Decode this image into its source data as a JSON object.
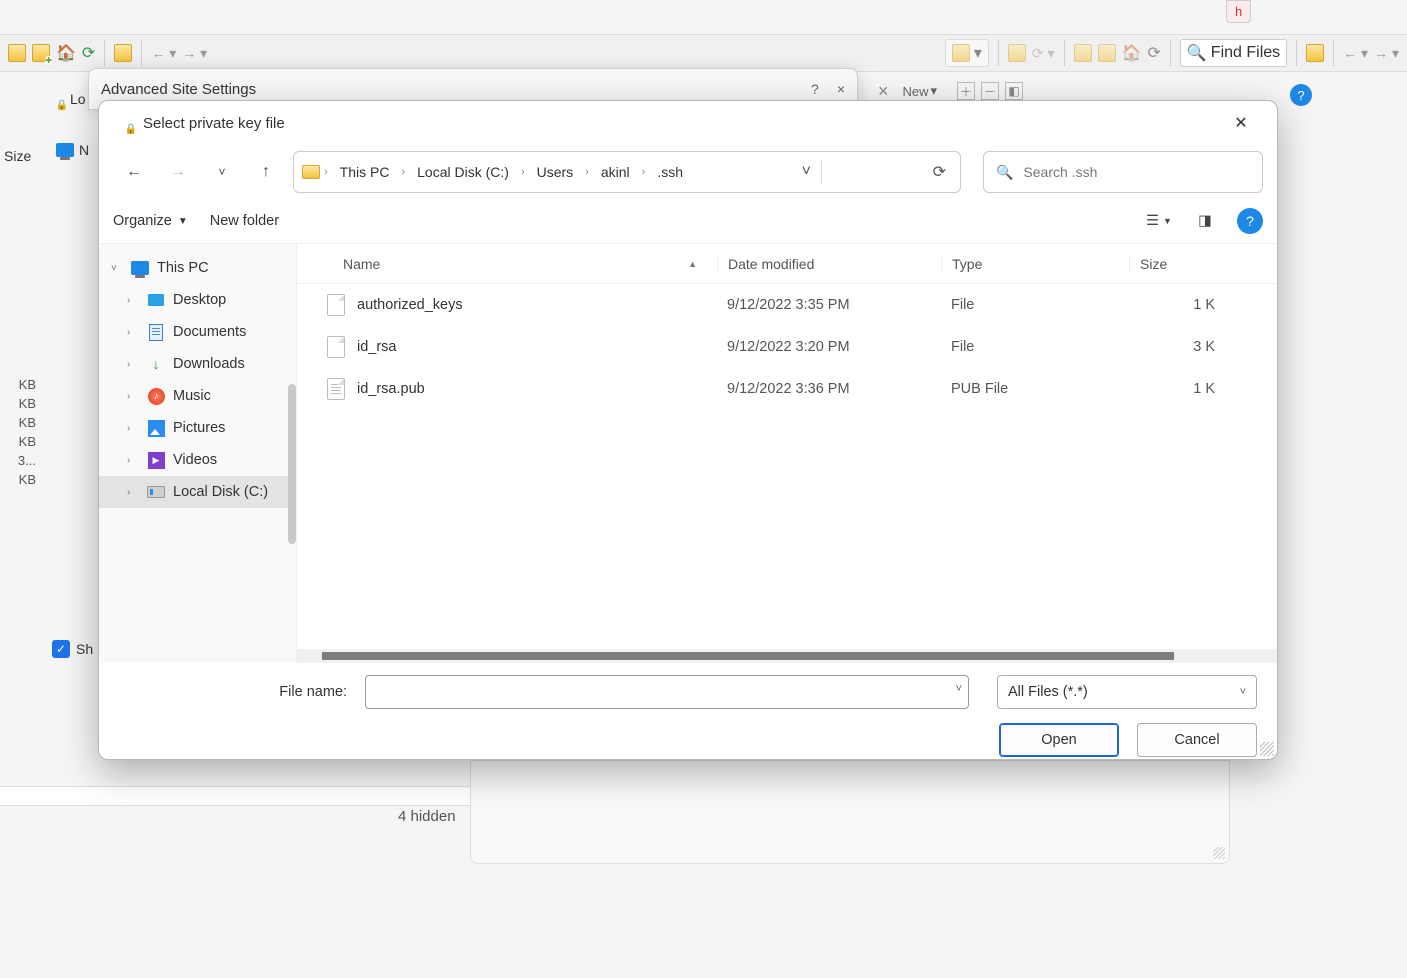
{
  "bg": {
    "h_tab": "h",
    "find_files": "Find Files",
    "new_label": "New",
    "size_hdr": "Size",
    "lo_label": "Lo",
    "n_label": "N",
    "sh_label": "Sh",
    "hidden_status": "4 hidden",
    "kb_rows": [
      "KB",
      "KB",
      "KB",
      "KB",
      "3...",
      "KB"
    ]
  },
  "adv_window": {
    "title": "Advanced Site Settings",
    "help": "?",
    "close": "×"
  },
  "dialog": {
    "title": "Select private key file",
    "nav": {
      "back": "←",
      "fwd": "→",
      "recent": "˅",
      "up": "↑"
    },
    "breadcrumbs": [
      "This PC",
      "Local Disk (C:)",
      "Users",
      "akinl",
      ".ssh"
    ],
    "search_placeholder": "Search .ssh",
    "toolbar": {
      "organize": "Organize",
      "new_folder": "New folder"
    },
    "sidebar": {
      "root": "This PC",
      "items": [
        {
          "icon": "desktop",
          "label": "Desktop"
        },
        {
          "icon": "documents",
          "label": "Documents"
        },
        {
          "icon": "downloads",
          "label": "Downloads"
        },
        {
          "icon": "music",
          "label": "Music"
        },
        {
          "icon": "pictures",
          "label": "Pictures"
        },
        {
          "icon": "videos",
          "label": "Videos"
        },
        {
          "icon": "disk",
          "label": "Local Disk (C:)"
        }
      ]
    },
    "columns": {
      "name": "Name",
      "date": "Date modified",
      "type": "Type",
      "size": "Size"
    },
    "rows": [
      {
        "name": "authorized_keys",
        "date": "9/12/2022 3:35 PM",
        "type": "File",
        "size": "1 K"
      },
      {
        "name": "id_rsa",
        "date": "9/12/2022 3:20 PM",
        "type": "File",
        "size": "3 K"
      },
      {
        "name": "id_rsa.pub",
        "date": "9/12/2022 3:36 PM",
        "type": "PUB File",
        "size": "1 K"
      }
    ],
    "footer": {
      "fname_label": "File name:",
      "fname_value": "",
      "filter": "All Files (*.*)",
      "open": "Open",
      "cancel": "Cancel"
    }
  }
}
